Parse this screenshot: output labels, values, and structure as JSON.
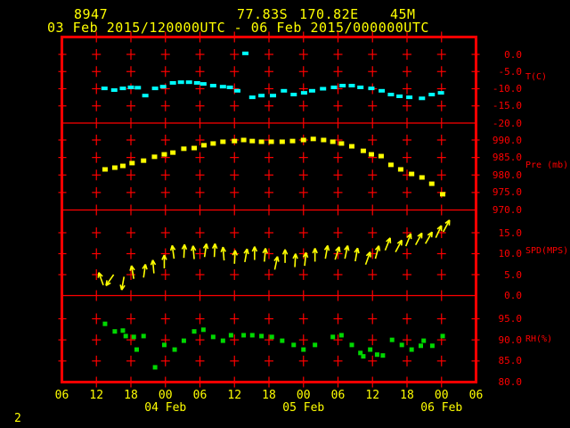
{
  "header": {
    "station_id": "8947",
    "latitude": "77.83S",
    "longitude": "170.82E",
    "elevation": "45M",
    "period": "03 Feb 2015/120000UTC - 06 Feb 2015/000000UTC"
  },
  "footer": {
    "page_number": "2"
  },
  "colors": {
    "background": "#000000",
    "axis": "#ff0000",
    "text_primary": "#ffff00",
    "temperature": "#00ffff",
    "pressure": "#ffff00",
    "wind": "#ffff00",
    "humidity": "#00d800"
  },
  "chart_data": {
    "type": "line",
    "title": "Surface meteogram for station 8947",
    "grid": true,
    "time_axis": {
      "hours_span": 72,
      "tick_labels": [
        "06",
        "12",
        "18",
        "00",
        "06",
        "12",
        "18",
        "00",
        "06",
        "12",
        "18",
        "00",
        "06"
      ],
      "date_labels": [
        {
          "text": "04 Feb",
          "tick_index": 3
        },
        {
          "text": "05 Feb",
          "tick_index": 7
        },
        {
          "text": "06 Feb",
          "tick_index": 11
        }
      ]
    },
    "panels": [
      {
        "id": "temperature",
        "unit_label": "T(C)",
        "color": "#00ffff",
        "marker": "dash",
        "levels": [
          0,
          -5,
          -10,
          -15,
          -20
        ],
        "tick_labels": [
          "0.0",
          "-5.0",
          "-10.0",
          "-15.0",
          "-20.0"
        ],
        "points": [
          [
            7.4,
            -9.9
          ],
          [
            9.1,
            -10.4
          ],
          [
            10.6,
            -9.9
          ],
          [
            12.0,
            -9.6
          ],
          [
            13.2,
            -9.7
          ],
          [
            14.5,
            -12.0
          ],
          [
            16.2,
            -9.9
          ],
          [
            17.6,
            -9.4
          ],
          [
            19.3,
            -8.3
          ],
          [
            20.7,
            -8.1
          ],
          [
            22.1,
            -8.1
          ],
          [
            23.5,
            -8.3
          ],
          [
            24.6,
            -8.6
          ],
          [
            26.3,
            -9.1
          ],
          [
            28.0,
            -9.4
          ],
          [
            29.2,
            -9.6
          ],
          [
            30.5,
            -10.6
          ],
          [
            31.9,
            0.3
          ],
          [
            33.1,
            -12.5
          ],
          [
            34.7,
            -12.0
          ],
          [
            36.7,
            -12.0
          ],
          [
            38.6,
            -10.6
          ],
          [
            40.3,
            -11.7
          ],
          [
            42.1,
            -11.2
          ],
          [
            43.5,
            -10.6
          ],
          [
            45.4,
            -10.0
          ],
          [
            47.3,
            -9.6
          ],
          [
            48.8,
            -9.1
          ],
          [
            50.4,
            -9.1
          ],
          [
            51.9,
            -9.6
          ],
          [
            53.8,
            -9.9
          ],
          [
            55.6,
            -10.6
          ],
          [
            57.2,
            -11.7
          ],
          [
            58.7,
            -12.2
          ],
          [
            60.4,
            -12.5
          ],
          [
            62.6,
            -12.8
          ],
          [
            64.3,
            -11.7
          ],
          [
            65.9,
            -11.2
          ]
        ]
      },
      {
        "id": "pressure",
        "unit_label": "Pre (mb)",
        "color": "#ffff00",
        "marker": "dash",
        "levels": [
          990,
          985,
          980,
          975,
          970
        ],
        "tick_labels": [
          "990.0",
          "985.0",
          "980.0",
          "975.0",
          "970.0"
        ],
        "points": [
          [
            7.5,
            981.6
          ],
          [
            9.2,
            982.1
          ],
          [
            10.6,
            982.6
          ],
          [
            12.2,
            983.4
          ],
          [
            14.2,
            984.1
          ],
          [
            16.1,
            985.2
          ],
          [
            17.8,
            985.9
          ],
          [
            19.3,
            986.4
          ],
          [
            21.2,
            987.5
          ],
          [
            23.0,
            987.7
          ],
          [
            24.7,
            988.5
          ],
          [
            26.3,
            989.0
          ],
          [
            28.0,
            989.5
          ],
          [
            30.0,
            989.7
          ],
          [
            31.6,
            990.0
          ],
          [
            33.1,
            989.7
          ],
          [
            34.7,
            989.5
          ],
          [
            36.4,
            989.5
          ],
          [
            38.3,
            989.5
          ],
          [
            40.1,
            989.7
          ],
          [
            42.0,
            990.0
          ],
          [
            43.7,
            990.3
          ],
          [
            45.5,
            990.0
          ],
          [
            47.1,
            989.5
          ],
          [
            48.6,
            989.0
          ],
          [
            50.4,
            988.2
          ],
          [
            52.4,
            986.9
          ],
          [
            53.8,
            985.9
          ],
          [
            55.5,
            985.4
          ],
          [
            57.2,
            982.9
          ],
          [
            58.9,
            981.6
          ],
          [
            60.8,
            980.3
          ],
          [
            62.6,
            979.3
          ],
          [
            64.3,
            977.5
          ],
          [
            66.2,
            974.5
          ]
        ]
      },
      {
        "id": "wind_speed",
        "unit_label": "SPD(MPS)",
        "color": "#ffff00",
        "marker": "arrow",
        "levels": [
          15,
          10,
          5,
          0
        ],
        "tick_labels": [
          "15.0",
          "10.0",
          "5.0",
          "0.0"
        ],
        "points": [
          [
            7.2,
            2.5,
            -20
          ],
          [
            9.0,
            5.0,
            -145
          ],
          [
            10.8,
            4.5,
            -170
          ],
          [
            12.5,
            4.0,
            -10
          ],
          [
            14.2,
            4.3,
            8
          ],
          [
            16.0,
            5.3,
            -5
          ],
          [
            17.8,
            6.5,
            0
          ],
          [
            19.5,
            8.8,
            -8
          ],
          [
            21.2,
            9.0,
            3
          ],
          [
            23.0,
            8.7,
            -5
          ],
          [
            24.8,
            9.2,
            8
          ],
          [
            26.5,
            9.2,
            3
          ],
          [
            28.2,
            8.4,
            -5
          ],
          [
            30.0,
            7.6,
            3
          ],
          [
            31.8,
            8.0,
            10
          ],
          [
            33.5,
            8.5,
            0
          ],
          [
            35.2,
            8.1,
            5
          ],
          [
            37.0,
            6.2,
            12
          ],
          [
            38.8,
            7.8,
            0
          ],
          [
            40.5,
            6.8,
            3
          ],
          [
            42.2,
            7.1,
            6
          ],
          [
            44.0,
            8.1,
            0
          ],
          [
            45.8,
            8.8,
            10
          ],
          [
            47.5,
            8.6,
            18
          ],
          [
            49.2,
            8.8,
            12
          ],
          [
            51.0,
            8.2,
            10
          ],
          [
            52.8,
            7.4,
            20
          ],
          [
            54.5,
            8.8,
            15
          ],
          [
            56.2,
            10.8,
            22
          ],
          [
            58.0,
            10.4,
            28
          ],
          [
            59.8,
            11.8,
            22
          ],
          [
            61.5,
            12.1,
            28
          ],
          [
            63.2,
            12.4,
            30
          ],
          [
            65.0,
            13.8,
            25
          ],
          [
            66.3,
            15.2,
            28
          ]
        ]
      },
      {
        "id": "relative_humidity",
        "unit_label": "RH(%)",
        "color": "#00d800",
        "marker": "square",
        "levels": [
          95,
          90,
          85,
          80
        ],
        "tick_labels": [
          "95.0",
          "90.0",
          "85.0",
          "80.0"
        ],
        "points": [
          [
            7.5,
            93.8
          ],
          [
            9.2,
            92.0
          ],
          [
            10.6,
            92.2
          ],
          [
            11.1,
            90.9
          ],
          [
            12.5,
            90.7
          ],
          [
            13.0,
            87.7
          ],
          [
            14.2,
            90.9
          ],
          [
            16.2,
            83.5
          ],
          [
            17.8,
            88.8
          ],
          [
            19.6,
            87.7
          ],
          [
            21.2,
            89.8
          ],
          [
            23.0,
            92.0
          ],
          [
            24.6,
            92.4
          ],
          [
            26.3,
            90.7
          ],
          [
            28.0,
            89.8
          ],
          [
            29.4,
            91.1
          ],
          [
            31.6,
            91.1
          ],
          [
            33.1,
            91.1
          ],
          [
            34.7,
            90.9
          ],
          [
            36.5,
            90.7
          ],
          [
            38.3,
            89.8
          ],
          [
            40.3,
            88.8
          ],
          [
            42.0,
            87.7
          ],
          [
            44.0,
            88.8
          ],
          [
            47.1,
            90.7
          ],
          [
            48.6,
            91.1
          ],
          [
            50.4,
            88.8
          ],
          [
            51.9,
            86.9
          ],
          [
            52.4,
            86.1
          ],
          [
            53.6,
            87.7
          ],
          [
            54.8,
            86.5
          ],
          [
            55.8,
            86.3
          ],
          [
            57.4,
            90.0
          ],
          [
            59.1,
            88.8
          ],
          [
            60.8,
            87.7
          ],
          [
            62.4,
            88.6
          ],
          [
            62.9,
            89.8
          ],
          [
            64.4,
            88.6
          ],
          [
            66.2,
            90.9
          ]
        ]
      }
    ]
  }
}
